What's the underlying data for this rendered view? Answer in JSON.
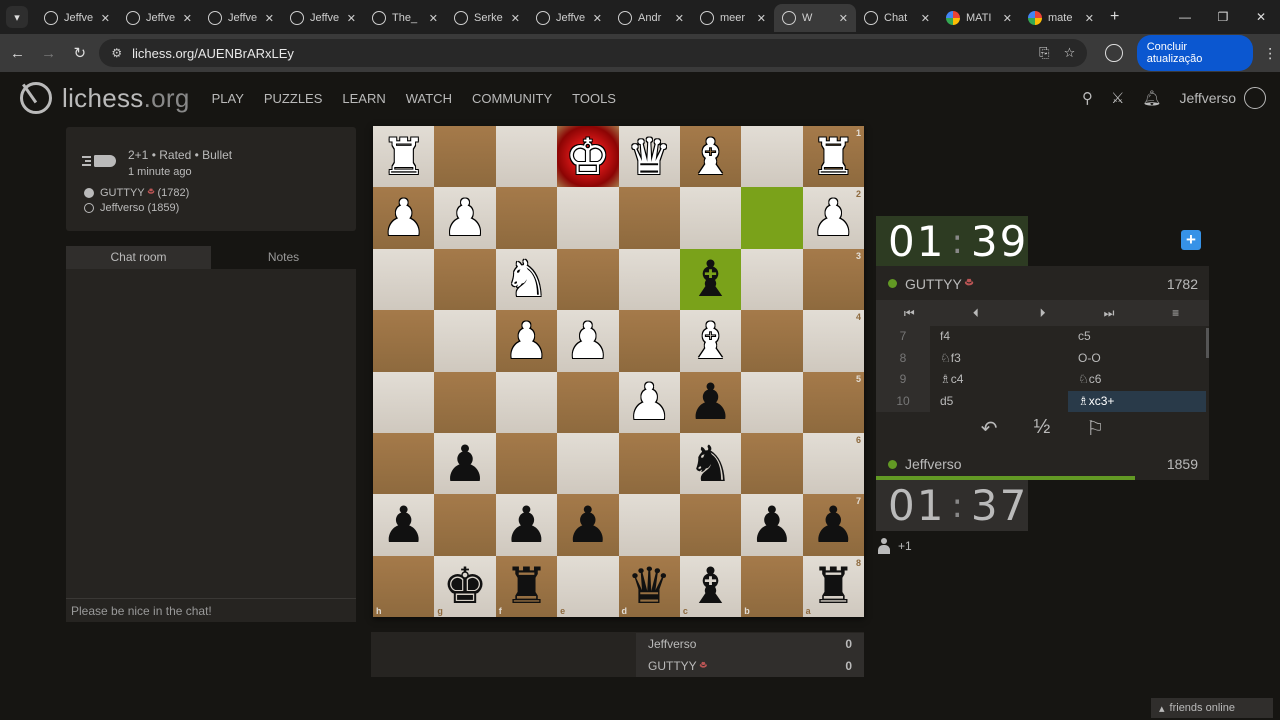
{
  "browser": {
    "tabs": [
      {
        "title": "Jeffve",
        "fav": "lichess"
      },
      {
        "title": "Jeffve",
        "fav": "lichess"
      },
      {
        "title": "Jeffve",
        "fav": "lichess"
      },
      {
        "title": "Jeffve",
        "fav": "lichess"
      },
      {
        "title": "The_",
        "fav": "lichess"
      },
      {
        "title": "Serke",
        "fav": "lichess"
      },
      {
        "title": "Jeffve",
        "fav": "lichess"
      },
      {
        "title": "Andr",
        "fav": "lichess"
      },
      {
        "title": "meer",
        "fav": "lichess"
      },
      {
        "title": "W",
        "fav": "lichess",
        "active": true
      },
      {
        "title": "Chat",
        "fav": "openai"
      },
      {
        "title": "MATI",
        "fav": "google"
      },
      {
        "title": "mate",
        "fav": "google"
      }
    ],
    "url": "lichess.org/AUENBrARxLEy",
    "update_label": "Concluir atualização"
  },
  "site": {
    "logo_main": "lichess",
    "logo_suffix": ".org",
    "nav": [
      "PLAY",
      "PUZZLES",
      "LEARN",
      "WATCH",
      "COMMUNITY",
      "TOOLS"
    ],
    "username": "Jeffverso"
  },
  "game": {
    "mode": "2+1 • Rated • Bullet",
    "time_ago": "1 minute ago",
    "white_player": "GUTTYY",
    "white_rating": "(1782)",
    "black_player": "Jeffverso (1859)"
  },
  "chat": {
    "tab_chat": "Chat room",
    "tab_notes": "Notes",
    "placeholder": "Please be nice in the chat!"
  },
  "board": {
    "ranks": [
      "1",
      "2",
      "3",
      "4",
      "5",
      "6",
      "7",
      "8"
    ],
    "files": [
      "h",
      "g",
      "f",
      "e",
      "d",
      "c",
      "b",
      "a"
    ],
    "rows": [
      [
        "wR",
        "",
        "",
        "wK",
        "wQ",
        "wB",
        "",
        "wR"
      ],
      [
        "wP",
        "wP",
        "",
        "",
        "",
        "",
        "",
        "wP"
      ],
      [
        "",
        "",
        "wN",
        "",
        "",
        "bB",
        "",
        ""
      ],
      [
        "",
        "",
        "wP",
        "wP",
        "",
        "wB",
        "",
        ""
      ],
      [
        "",
        "",
        "",
        "",
        "wP",
        "bP",
        "",
        ""
      ],
      [
        "",
        "bP",
        "",
        "",
        "",
        "bN",
        "",
        ""
      ],
      [
        "bP",
        "",
        "bP",
        "bP",
        "",
        "",
        "bP",
        "bP"
      ],
      [
        "",
        "bK",
        "bR",
        "",
        "bQ",
        "bB",
        "",
        "bR"
      ]
    ],
    "highlights": [
      "1,6",
      "2,5"
    ],
    "check_square": "0,3"
  },
  "scores": [
    {
      "name": "Jeffverso",
      "value": "0"
    },
    {
      "name": "GUTTYY",
      "value": "0"
    }
  ],
  "clocks": {
    "top": {
      "min": "01",
      "sec": "39"
    },
    "bottom": {
      "min": "01",
      "sec": "37"
    }
  },
  "panel": {
    "top_player": "GUTTYY",
    "top_rating": "1782",
    "bottom_player": "Jeffverso",
    "bottom_rating": "1859",
    "moves": [
      {
        "n": "7",
        "w": "f4",
        "b": "c5"
      },
      {
        "n": "8",
        "w": "♘f3",
        "b": "O-O"
      },
      {
        "n": "9",
        "w": "♗c4",
        "b": "♘c6"
      },
      {
        "n": "10",
        "w": "d5",
        "b": "♗xc3+"
      }
    ],
    "draw_label": "½"
  },
  "spectators": "+1",
  "friends_online": "friends online"
}
